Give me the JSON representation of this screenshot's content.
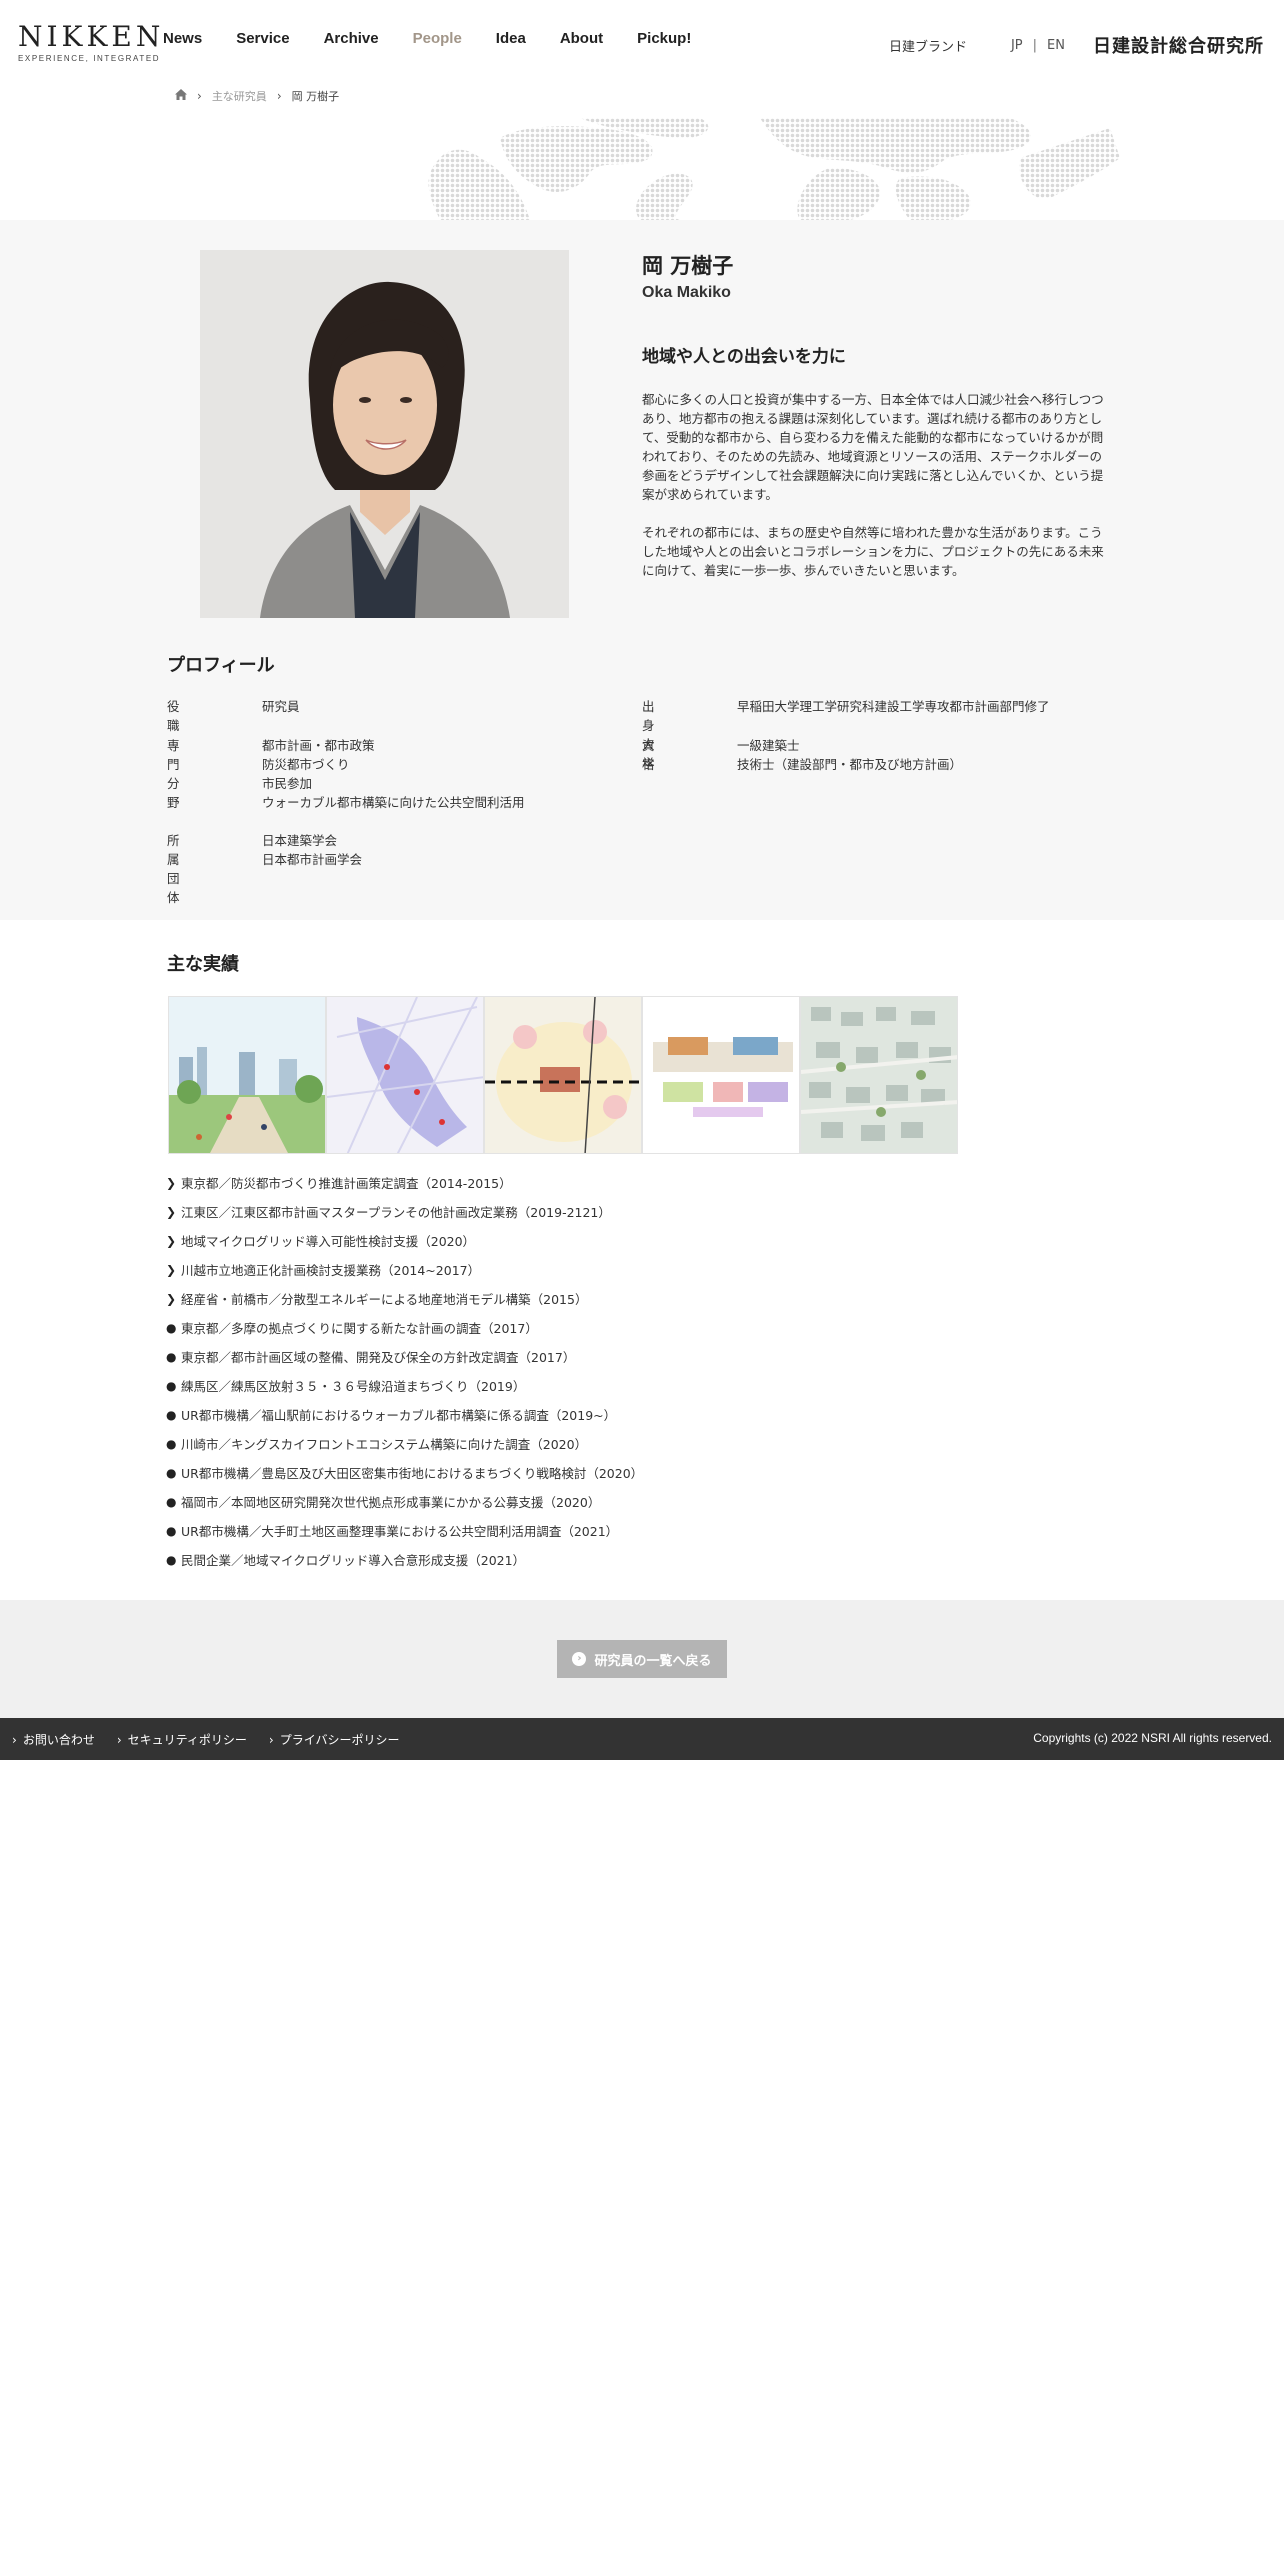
{
  "header": {
    "logo_main": "NIKKEN",
    "logo_sub": "EXPERIENCE, INTEGRATED",
    "nav": [
      "News",
      "Service",
      "Archive",
      "People",
      "Idea",
      "About",
      "Pickup!"
    ],
    "active_nav": "People",
    "brand_link": "日建ブランド",
    "lang_jp": "JP",
    "lang_sep": "|",
    "lang_en": "EN",
    "corp_name": "日建設計総合研究所"
  },
  "breadcrumb": {
    "home_icon": "home-icon",
    "level1": "主な研究員",
    "current": "岡 万樹子"
  },
  "profile": {
    "name_jp": "岡 万樹子",
    "name_en": "Oka Makiko",
    "catchphrase": "地域や人との出会いを力に",
    "bio": [
      "都心に多くの人口と投資が集中する一方、日本全体では人口減少社会へ移行しつつあり、地方都市の抱える課題は深刻化しています。選ばれ続ける都市のあり方として、受動的な都市から、自ら変わる力を備えた能動的な都市になっていけるかが問われており、そのための先読み、地域資源とリソースの活用、ステークホルダーの参画をどうデザインして社会課題解決に向け実践に落とし込んでいくか、という提案が求められています。",
      "それぞれの都市には、まちの歴史や自然等に培われた豊かな生活があります。こうした地域や人との出会いとコラボレーションを力に、プロジェクトの先にある未来に向けて、着実に一歩一歩、歩んでいきたいと思います。"
    ],
    "section_title": "プロフィール",
    "rows": [
      {
        "label": "役職",
        "values": [
          "研究員"
        ]
      },
      {
        "label": "出身大学",
        "values": [
          "早稲田大学理工学研究科建設工学専攻都市計画部門修了"
        ]
      },
      {
        "label": "専門分野",
        "values": [
          "都市計画・都市政策",
          "防災都市づくり",
          "市民参加",
          "ウォーカブル都市構築に向けた公共空間利活用"
        ]
      },
      {
        "label": "資格",
        "values": [
          "一級建築士",
          "技術士（建設部門・都市及び地方計画）"
        ]
      },
      {
        "label": "所属団体",
        "values": [
          "日本建築学会",
          "日本都市計画学会"
        ]
      }
    ]
  },
  "achievements": {
    "title": "主な実績",
    "items": [
      {
        "mark": "chevron",
        "text": "東京都／防災都市づくり推進計画策定調査（2014-2015）"
      },
      {
        "mark": "chevron",
        "text": "江東区／江東区都市計画マスタープランその他計画改定業務（2019-2121）"
      },
      {
        "mark": "chevron",
        "text": "地域マイクログリッド導入可能性検討支援（2020）"
      },
      {
        "mark": "chevron",
        "text": "川越市立地適正化計画検討支援業務（2014~2017）"
      },
      {
        "mark": "chevron",
        "text": "経産省・前橋市／分散型エネルギーによる地産地消モデル構築（2015）"
      },
      {
        "mark": "bullet",
        "text": "東京都／多摩の拠点づくりに関する新たな計画の調査（2017）"
      },
      {
        "mark": "bullet",
        "text": "東京都／都市計画区域の整備、開発及び保全の方針改定調査（2017）"
      },
      {
        "mark": "bullet",
        "text": "練馬区／練馬区放射３５・３６号線沿道まちづくり（2019）"
      },
      {
        "mark": "bullet",
        "text": "UR都市機構／福山駅前におけるウォーカブル都市構築に係る調査（2019~）"
      },
      {
        "mark": "bullet",
        "text": "川崎市／キングスカイフロントエコシステム構築に向けた調査（2020）"
      },
      {
        "mark": "bullet",
        "text": "UR都市機構／豊島区及び大田区密集市街地におけるまちづくり戦略検討（2020）"
      },
      {
        "mark": "bullet",
        "text": "福岡市／本岡地区研究開発次世代拠点形成事業にかかる公募支援（2020）"
      },
      {
        "mark": "bullet",
        "text": "UR都市機構／大手町土地区画整理事業における公共空間利活用調査（2021）"
      },
      {
        "mark": "bullet",
        "text": "民間企業／地域マイクログリッド導入合意形成支援（2021）"
      }
    ]
  },
  "back_button": "研究員の一覧へ戻る",
  "footer": {
    "links": [
      "お問い合わせ",
      "セキュリティポリシー",
      "プライバシーポリシー"
    ],
    "copyright": "Copyrights (c) 2022 NSRI All rights reserved."
  }
}
